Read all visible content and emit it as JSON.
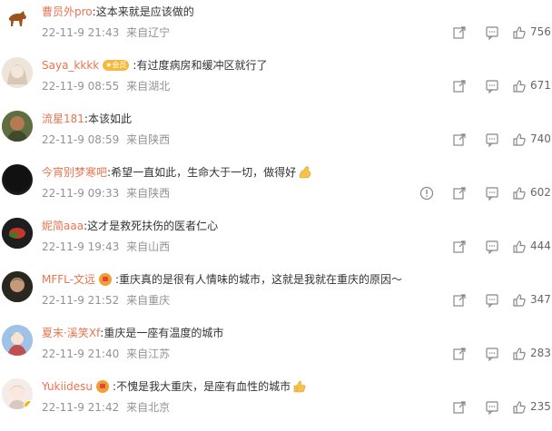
{
  "comments": [
    {
      "name": "曹员外pro",
      "sep": ":",
      "text": "这本来就是应该做的",
      "time": "22-11-9 21:43",
      "loc": "来自辽宁",
      "likes": "756"
    },
    {
      "name": "Saya_kkkk",
      "vip": "★会员",
      "sep": ":",
      "text": "有过度病房和缓冲区就行了",
      "time": "22-11-9 08:55",
      "loc": "来自湖北",
      "likes": "671"
    },
    {
      "name": "流星181",
      "sep": ":",
      "text": "本该如此",
      "time": "22-11-9 08:59",
      "loc": "来自陕西",
      "likes": "740"
    },
    {
      "name": "今宵别梦寒吧",
      "sep": ":",
      "text": "希望一直如此，生命大于一切，做得好",
      "time": "22-11-9 09:33",
      "loc": "来自陕西",
      "likes": "602"
    },
    {
      "name": "妮简aaa",
      "sep": ":",
      "text": "这才是救死扶伤的医者仁心",
      "time": "22-11-9 19:43",
      "loc": "来自山西",
      "likes": "444"
    },
    {
      "name": "MFFL-文远",
      "sep": ":",
      "text": "重庆真的是很有人情味的城市，这就是我就在重庆的原因～",
      "time": "22-11-9 21:52",
      "loc": "来自重庆",
      "likes": "347"
    },
    {
      "name": "夏末·溪笑Xf",
      "sep": ":",
      "text": "重庆是一座有温度的城市",
      "time": "22-11-9 21:40",
      "loc": "来自江苏",
      "likes": "283"
    },
    {
      "name": "Yukiidesu",
      "sep": ":",
      "text": "不愧是我大重庆，是座有血性的城市",
      "time": "22-11-9 21:42",
      "loc": "来自北京",
      "likes": "235"
    }
  ]
}
